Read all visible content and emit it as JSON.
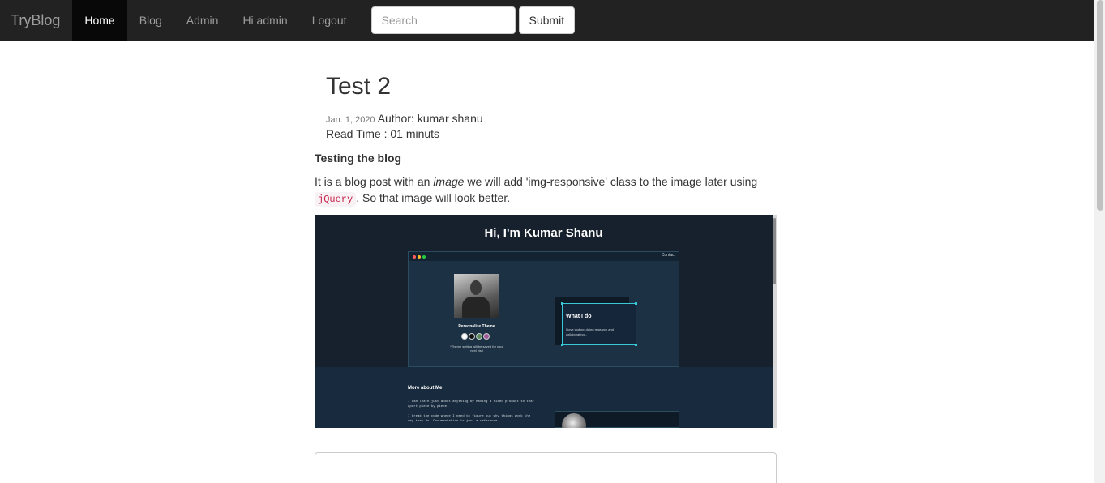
{
  "navbar": {
    "brand": "TryBlog",
    "links": [
      {
        "label": "Home",
        "active": true
      },
      {
        "label": "Blog",
        "active": false
      },
      {
        "label": "Admin",
        "active": false
      },
      {
        "label": "Hi admin",
        "active": false
      },
      {
        "label": "Logout",
        "active": false
      }
    ],
    "search": {
      "placeholder": "Search",
      "value": ""
    },
    "submit_label": "Submit"
  },
  "post": {
    "title": "Test 2",
    "date": "Jan. 1, 2020",
    "author": "Author: kumar shanu",
    "read_time": "Read Time : 01 minuts",
    "subheading": "Testing the blog",
    "body": {
      "part1": "It is a blog post with an ",
      "emphasis": "image",
      "part2": " we will add 'img-responsive' class to the image later using ",
      "code": "jQuery",
      "part3": ". So that image will look better."
    },
    "image": {
      "hero_title": "Hi, I'm Kumar Shanu",
      "window_link": "Contact",
      "theme_label": "Personalize Theme",
      "swatch_colors": [
        "#ffffff",
        "#111111",
        "#5a8a5a",
        "#a05a9a"
      ],
      "theme_note": "*Theme setting will be saved for your next visit",
      "card_title": "What I do",
      "card_text": "I love coding, doing research and collaborating...",
      "more_title": "More about Me",
      "more_p1": "I can learn just about anything by having a fixed product to tear apart piece by piece.",
      "more_p2": "I break the code where I need to figure out why things work the way they do. Documentation is just a reference."
    }
  },
  "colors": {
    "navbar_bg": "#222222",
    "active_bg": "#080808",
    "code_color": "#c7254e",
    "image_bg": "#16212d",
    "card_border": "#38c8d8"
  }
}
